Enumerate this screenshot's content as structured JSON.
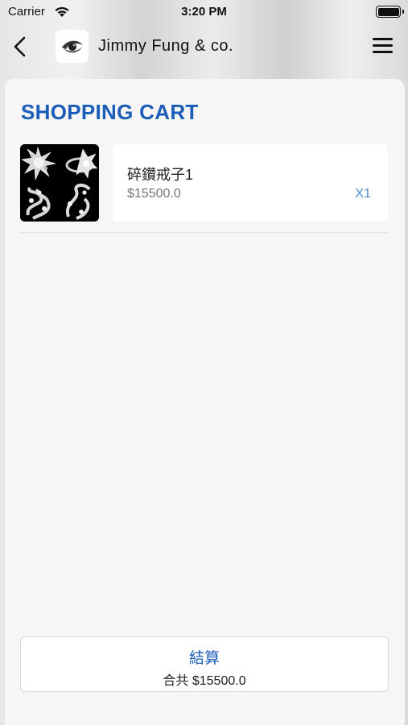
{
  "status_bar": {
    "carrier": "Carrier",
    "time": "3:20 PM",
    "battery_level": 1.0
  },
  "nav": {
    "brand_name": "Jimmy Fung & co.",
    "icons": {
      "back": "chevron-left-icon",
      "menu": "hamburger-menu-icon"
    }
  },
  "cart": {
    "title": "SHOPPING CART",
    "items": [
      {
        "name": "碎鑽戒子1",
        "price": "$15500.0",
        "quantity": "X1"
      }
    ]
  },
  "checkout": {
    "label": "結算",
    "total": "合共 $15500.0"
  },
  "colors": {
    "accent": "#1b5db8",
    "quantity": "#4a8ad6",
    "price": "#777777"
  }
}
